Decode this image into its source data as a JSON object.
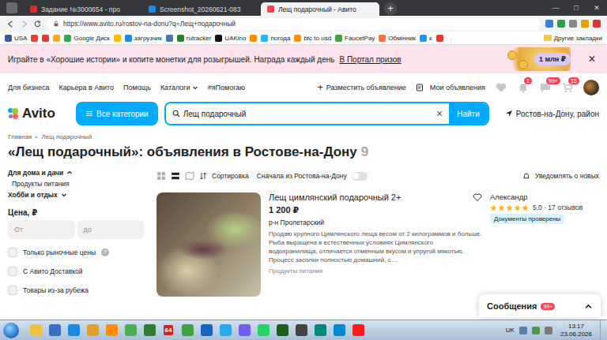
{
  "browser": {
    "tabs": [
      {
        "label": "Задание №3000654 - про",
        "selected": false,
        "color": "#d32f2f"
      },
      {
        "label": "Screenshot_20260621-083",
        "selected": false,
        "color": "#1e88e5"
      },
      {
        "label": "Лещ подарочный - Авито",
        "selected": true,
        "color": "#ff4053"
      }
    ],
    "new_tab": "+",
    "window_controls": [
      "—",
      "□",
      "✕"
    ],
    "url": "https://www.avito.ru/rostov-na-donu?q=Лещ+подарочный",
    "bookmarks": [
      {
        "kind": "link",
        "label": "USA",
        "color": "#3b5998"
      },
      {
        "kind": "icon",
        "color": "#ea4335"
      },
      {
        "kind": "icon",
        "color": "#e53935"
      },
      {
        "kind": "icon",
        "color": "#f9a825"
      },
      {
        "kind": "link",
        "label": "Google Диск",
        "color": "#34a853"
      },
      {
        "kind": "icon",
        "color": "#fbbc04"
      },
      {
        "kind": "link",
        "label": "загрузчик",
        "color": "#1e88e5"
      },
      {
        "kind": "icon",
        "color": "#4a76a8"
      },
      {
        "kind": "link",
        "label": "rutracker",
        "color": "#2e7d32"
      },
      {
        "kind": "link",
        "label": "UAKino",
        "color": "#111111"
      },
      {
        "kind": "icon",
        "color": "#fb8c00"
      },
      {
        "kind": "link",
        "label": "погода",
        "color": "#29b6f6"
      },
      {
        "kind": "link",
        "label": "btc to usd",
        "color": "#f7931a"
      },
      {
        "kind": "link",
        "label": "FaucetPay",
        "color": "#43a047"
      },
      {
        "kind": "link",
        "label": "Обмінник",
        "color": "#ff7043"
      },
      {
        "kind": "link",
        "label": "к",
        "color": "#2196f3"
      },
      {
        "kind": "icon",
        "color": "#e53935"
      }
    ],
    "other_bookmarks": "Другие закладки"
  },
  "banner": {
    "text": "Играйте в «Хорошие истории» и копите монетки для розыгрышей. Награда каждый день",
    "link": "В Портал призов",
    "prize": "1 млн ₽",
    "close": "×"
  },
  "nav": {
    "links": [
      {
        "label": "Для бизнеса",
        "dropdown": false
      },
      {
        "label": "Карьера в Авито",
        "dropdown": false
      },
      {
        "label": "Помощь",
        "dropdown": false
      },
      {
        "label": "Каталоги",
        "dropdown": true
      },
      {
        "label": "#яПомогаю",
        "dropdown": false
      }
    ],
    "post_icon": "+",
    "post": "Разместить объявление",
    "my_ads": "Мои объявления",
    "icons": [
      {
        "kind": "heart"
      },
      {
        "kind": "bell",
        "badge": "1"
      },
      {
        "kind": "chat",
        "badge": "99+"
      },
      {
        "kind": "cart",
        "badge": "15"
      }
    ]
  },
  "search": {
    "logo": "Avito",
    "categories": "Все категории",
    "query": "Лещ подарочный",
    "clear": "×",
    "button": "Найти",
    "location": "Ростов-на-Дону, район"
  },
  "breadcrumbs": [
    "Главная",
    "Лещ подарочный"
  ],
  "heading": {
    "title": "«Лещ подарочный»: объявления в Ростове-на-Дону",
    "count": "9"
  },
  "filters": {
    "categories": [
      {
        "label": "Для дома и дачи",
        "expanded": true,
        "children": [
          "Продукты питания"
        ]
      },
      {
        "label": "Хобби и отдых",
        "expanded": false,
        "children": []
      }
    ],
    "price": {
      "label": "Цена, ₽",
      "from": "От",
      "to": "до"
    },
    "checkboxes": [
      {
        "label": "Только рыночные цены",
        "checked": false,
        "help": "?"
      },
      {
        "label": "С Авито Доставкой",
        "checked": false
      },
      {
        "label": "Товары из-за рубежа",
        "checked": false
      }
    ]
  },
  "toolbar": {
    "views": [
      {
        "kind": "grid",
        "selected": false
      },
      {
        "kind": "list",
        "selected": true
      },
      {
        "kind": "map",
        "selected": false
      }
    ],
    "sort": "Сортировка",
    "rostov_first": {
      "label": "Сначала из Ростова-на-Дону",
      "on": false
    },
    "notify": "Уведомлять о новых"
  },
  "listings": [
    {
      "title": "Лещ цимлянский подарочный 2+",
      "price": "1 200 ₽",
      "location": "р-н Пролетарский",
      "description": "Продаю крупного Цимлянского леща весом от 2 килограммов и больше. Рыба выращена в естественных условиях Цимлянского водохранилища, отличается отменным вкусом и упругой мякотью. Процесс засолки полностью домашний, с…",
      "category": "Продукты питания",
      "favorite": false,
      "seller": {
        "name": "Александр",
        "stars": 5,
        "rating_text": "5,0 · 17 отзывов",
        "badge": "Документы проверены"
      }
    }
  ],
  "messages": {
    "label": "Сообщения",
    "badge": "99+"
  },
  "taskbar": {
    "apps": [
      {
        "kind": "icon",
        "color": "#f0c040"
      },
      {
        "kind": "icon",
        "color": "#3a6fc4"
      },
      {
        "kind": "icon",
        "color": "#1e88e5"
      },
      {
        "kind": "icon",
        "color": "#e0a030"
      },
      {
        "kind": "icon",
        "color": "#ff8f00"
      },
      {
        "kind": "icon",
        "color": "#4caf50"
      },
      {
        "kind": "icon",
        "color": "#2e7d32"
      },
      {
        "kind": "text",
        "label": "64",
        "color": "#c62828"
      },
      {
        "kind": "icon",
        "color": "#43a047"
      },
      {
        "kind": "icon",
        "color": "#1565c0"
      },
      {
        "kind": "icon",
        "color": "#29a9eb"
      },
      {
        "kind": "icon",
        "color": "#7360f2"
      },
      {
        "kind": "icon",
        "color": "#25d366"
      },
      {
        "kind": "icon",
        "color": "#1b5e20"
      },
      {
        "kind": "icon",
        "color": "#424242"
      },
      {
        "kind": "icon",
        "color": "#00897b"
      },
      {
        "kind": "icon",
        "color": "#0288d1"
      },
      {
        "kind": "icon",
        "color": "#ff1a1a"
      }
    ],
    "lang": "UK",
    "time": "13:17",
    "date": "23.06.2026"
  }
}
